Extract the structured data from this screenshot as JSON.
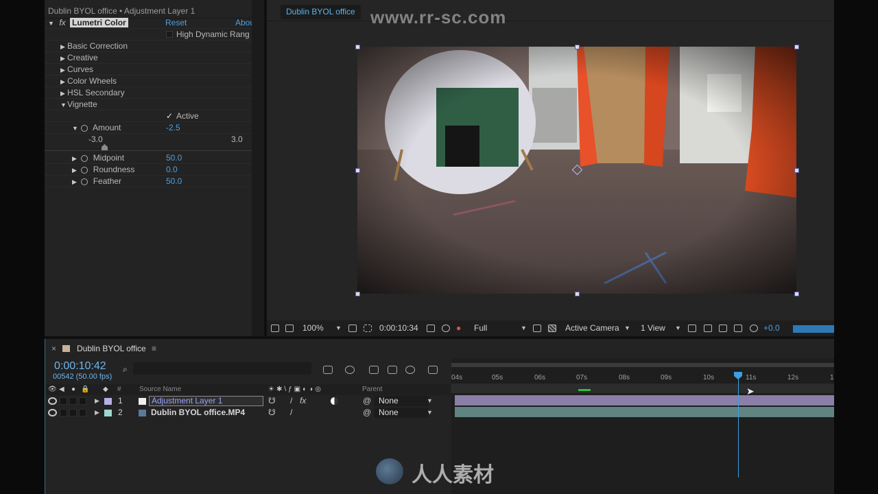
{
  "watermark": {
    "site": "www.rr-sc.com",
    "logo_text": "人人素材"
  },
  "effect_controls": {
    "header": "Dublin BYOL office • Adjustment Layer 1",
    "effect_name": "Lumetri Color",
    "reset_label": "Reset",
    "about_label": "Abou",
    "hdr_label": "High Dynamic Rang",
    "sections": [
      {
        "label": "Basic Correction"
      },
      {
        "label": "Creative"
      },
      {
        "label": "Curves"
      },
      {
        "label": "Color Wheels"
      },
      {
        "label": "HSL Secondary"
      },
      {
        "label": "Vignette"
      }
    ],
    "vignette": {
      "active_label": "Active",
      "amount": {
        "label": "Amount",
        "value": "-2.5",
        "slider_min": "-3.0",
        "slider_max": "3.0",
        "slider_fraction": 0.083
      },
      "midpoint": {
        "label": "Midpoint",
        "value": "50.0"
      },
      "roundness": {
        "label": "Roundness",
        "value": "0.0"
      },
      "feather": {
        "label": "Feather",
        "value": "50.0"
      }
    }
  },
  "composition": {
    "tab_label": "Dublin BYOL office",
    "toolbar": {
      "zoom": "100%",
      "timecode": "0:00:10:34",
      "resolution": "Full",
      "camera": "Active Camera",
      "views": "1 View",
      "exposure": "+0.0"
    }
  },
  "timeline": {
    "tab_label": "Dublin BYOL office",
    "timecode": "0:00:10:42",
    "frame_info": "00542 (50.00 fps)",
    "columns": {
      "num": "#",
      "source_name": "Source Name",
      "parent": "Parent"
    },
    "layers": [
      {
        "index": "1",
        "name": "Adjustment Layer 1",
        "parent": "None",
        "color": "#b6b0e6"
      },
      {
        "index": "2",
        "name": "Dublin BYOL office.MP4",
        "parent": "None",
        "color": "#9fd8cf"
      }
    ],
    "ruler_labels": [
      "04s",
      "05s",
      "06s",
      "07s",
      "08s",
      "09s",
      "10s",
      "11s",
      "12s",
      "1"
    ]
  },
  "colors": {
    "accent_blue": "#4fa0e0",
    "adjustment_bar": "#8b7fa9",
    "footage_bar": "#5f8481"
  }
}
